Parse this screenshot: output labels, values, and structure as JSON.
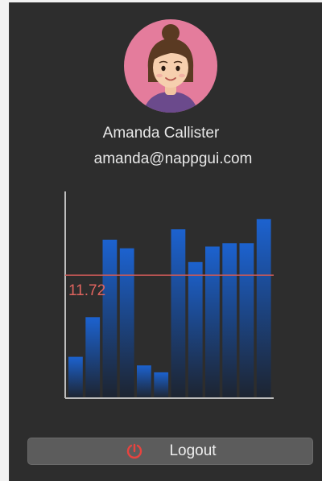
{
  "user": {
    "name": "Amanda Callister",
    "email": "amanda@nappgui.com"
  },
  "chart_data": {
    "type": "bar",
    "values": [
      24,
      47,
      92,
      87,
      19,
      15,
      98,
      79,
      88,
      90,
      90,
      104
    ],
    "ylim": [
      0,
      120
    ],
    "reference_line": {
      "value": 71.4,
      "label": "11.72"
    },
    "colors": {
      "bar_top": "#1c62cf",
      "bar_bottom": "#1d2430",
      "line": "#cc5a57",
      "axis": "#bdbdbd"
    }
  },
  "logout": {
    "label": "Logout",
    "icon": "logout-power-icon"
  },
  "colors": {
    "background": "#2d2d2d",
    "avatar_bg": "#e47c9c",
    "button_bg": "#5c5c5c"
  }
}
